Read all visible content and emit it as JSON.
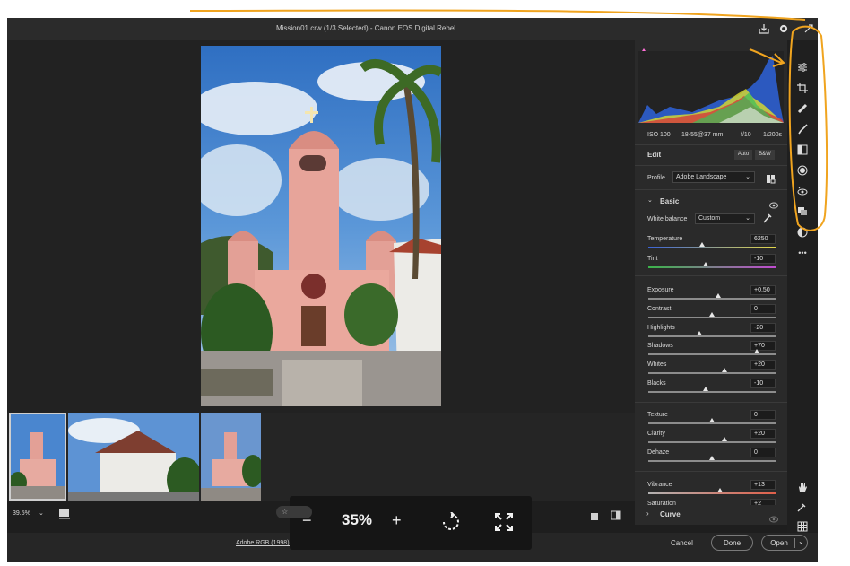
{
  "titlebar": {
    "title": "Mission01.crw (1/3 Selected)  -  Canon EOS Digital Rebel",
    "icons": [
      "save-icon",
      "gear-icon",
      "expand-icon"
    ]
  },
  "camera_info": {
    "iso": "ISO 100",
    "lens": "18-55@37 mm",
    "aperture": "f/10",
    "shutter": "1/200s"
  },
  "edit": {
    "title": "Edit",
    "auto_label": "Auto",
    "bw_label": "B&W",
    "profile_label": "Profile",
    "profile_value": "Adobe Landscape"
  },
  "basic": {
    "title": "Basic",
    "white_balance_label": "White balance",
    "white_balance_value": "Custom",
    "sliders": [
      {
        "label": "Temperature",
        "value": "6250",
        "pos": 0.42
      },
      {
        "label": "Tint",
        "value": "-10",
        "pos": 0.45
      },
      {
        "label": "Exposure",
        "value": "+0.50",
        "pos": 0.55
      },
      {
        "label": "Contrast",
        "value": "0",
        "pos": 0.5
      },
      {
        "label": "Highlights",
        "value": "-20",
        "pos": 0.4
      },
      {
        "label": "Shadows",
        "value": "+70",
        "pos": 0.85
      },
      {
        "label": "Whites",
        "value": "+20",
        "pos": 0.6
      },
      {
        "label": "Blacks",
        "value": "-10",
        "pos": 0.45
      },
      {
        "label": "Texture",
        "value": "0",
        "pos": 0.5
      },
      {
        "label": "Clarity",
        "value": "+20",
        "pos": 0.6
      },
      {
        "label": "Dehaze",
        "value": "0",
        "pos": 0.5
      },
      {
        "label": "Vibrance",
        "value": "+13",
        "pos": 0.56
      },
      {
        "label": "Saturation",
        "value": "+2",
        "pos": 0.51
      }
    ]
  },
  "curve": {
    "title": "Curve"
  },
  "view": {
    "zoom_label": "39.5%"
  },
  "zoom_popup": {
    "minus": "−",
    "value": "35%",
    "plus": "+"
  },
  "footer": {
    "info_link": "Adobe RGB (1998) - 8 bit - 2048 x 3072 (6.3MP) - 300 ppi",
    "cancel": "Cancel",
    "done": "Done",
    "open": "Open"
  },
  "tools": [
    "sliders-icon",
    "crop-icon",
    "healing-icon",
    "brush-icon",
    "gradient-icon",
    "radial-icon",
    "redeye-icon",
    "presets-icon",
    "snapshot-icon",
    "more-icon"
  ],
  "bottom_tools": [
    "hand-icon",
    "eyedropper-icon",
    "grid-icon"
  ],
  "colors": {
    "accent": "#f0a41f",
    "panel": "#2a2a2a",
    "background": "#1e1e1e"
  }
}
